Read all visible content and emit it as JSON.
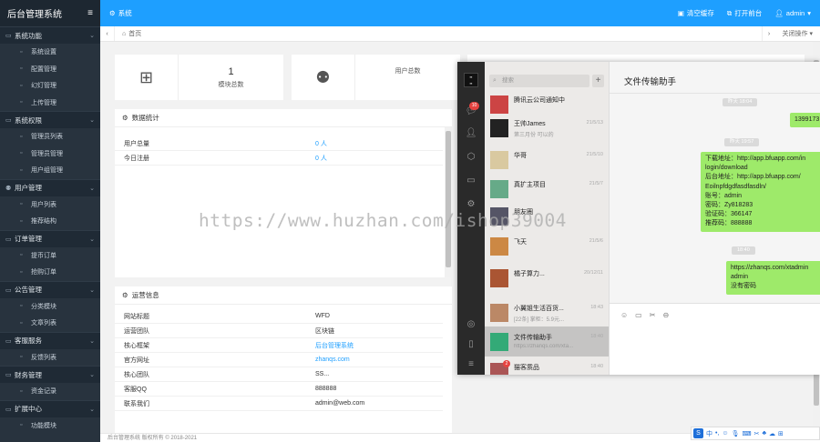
{
  "sidebar": {
    "title": "后台管理系统",
    "toggle_icon": "≡",
    "groups": [
      {
        "label": "系统功能",
        "items": [
          "系统设置",
          "配置管理",
          "幻灯管理",
          "上传管理"
        ]
      },
      {
        "label": "系统权限",
        "items": [
          "管理员列表",
          "管理员管理",
          "用户组管理"
        ]
      },
      {
        "label": "用户管理",
        "items": [
          "用户列表",
          "推荐结构"
        ]
      },
      {
        "label": "订单管理",
        "items": [
          "提币订单",
          "抢购订单"
        ]
      },
      {
        "label": "公告管理",
        "items": [
          "分类模块",
          "文章列表"
        ]
      },
      {
        "label": "客服服务",
        "items": [
          "反馈列表"
        ]
      },
      {
        "label": "财务管理",
        "items": [
          "资金记录"
        ]
      },
      {
        "label": "扩展中心",
        "items": [
          "功能模块"
        ]
      }
    ]
  },
  "topbar": {
    "crumb": "系统",
    "clear_cache": "清空缓存",
    "open_frontend": "打开前台",
    "user": "admin"
  },
  "tabs": {
    "home": "首页",
    "close_ops": "关闭操作"
  },
  "stats": [
    {
      "value": "1",
      "label": "模块总数"
    },
    {
      "value": "",
      "label": "用户总数"
    }
  ],
  "data_stats": {
    "title": "数据统计",
    "rows": [
      {
        "key": "用户总量",
        "value": "0 人"
      },
      {
        "key": "今日注册",
        "value": "0 人"
      }
    ]
  },
  "ops_info": {
    "title": "运营信息",
    "rows": [
      {
        "key": "网站标题",
        "value": "WFD",
        "link": false
      },
      {
        "key": "运营团队",
        "value": "区块链",
        "link": false
      },
      {
        "key": "核心框架",
        "value": "后台管理系统",
        "link": true
      },
      {
        "key": "官方网址",
        "value": "zhanqs.com",
        "link": true
      },
      {
        "key": "核心团队",
        "value": "SS...",
        "link": false
      },
      {
        "key": "客服QQ",
        "value": "888888",
        "link": false
      },
      {
        "key": "联系我们",
        "value": "admin@web.com",
        "link": false
      }
    ]
  },
  "footer": "后台管理系统 版权所有 © 2018-2021",
  "chat": {
    "search_placeholder": "搜索",
    "title": "文件传输助手",
    "contacts": [
      {
        "name": "腾讯云公司通知中",
        "sub": "",
        "time": ""
      },
      {
        "name": "王帅James",
        "sub": "第三月份 可以的",
        "time": "21/5/13"
      },
      {
        "name": "华哥",
        "sub": "",
        "time": "21/5/10"
      },
      {
        "name": "真扩主项目",
        "sub": "",
        "time": "21/5/7"
      },
      {
        "name": "朋友圈",
        "sub": "",
        "time": ""
      },
      {
        "name": "飞天",
        "sub": "",
        "time": "21/5/6"
      },
      {
        "name": "橘子算力...",
        "sub": "",
        "time": "20/12/11"
      },
      {
        "name": "小翼姐生活百货...",
        "sub": "[22条] 掌柜：5.9元...",
        "time": "18:43"
      },
      {
        "name": "文件传输助手",
        "sub": "https://zhanqs.com/xta...",
        "time": "18:40"
      },
      {
        "name": "猫客质品",
        "sub": "",
        "time": "18:40"
      }
    ],
    "times": [
      "昨天 18:04",
      "昨天 19:57",
      "18:40"
    ],
    "messages": [
      "1399173",
      "下载地址：http://app.bfuapp.com/in\nlogin/download\n后台地址：http://app.bfuapp.com/\nEoilnpfdgdfasdfasdln/\n账号：admin\n密码：Zy818283\n验证码：366147\n推荐码：888888",
      "https://zhanqs.com/xtadmin\nadmin\n没有密码"
    ]
  },
  "watermark": "https://www.huzhan.com/ishop39004",
  "ime": {
    "lang": "中"
  }
}
